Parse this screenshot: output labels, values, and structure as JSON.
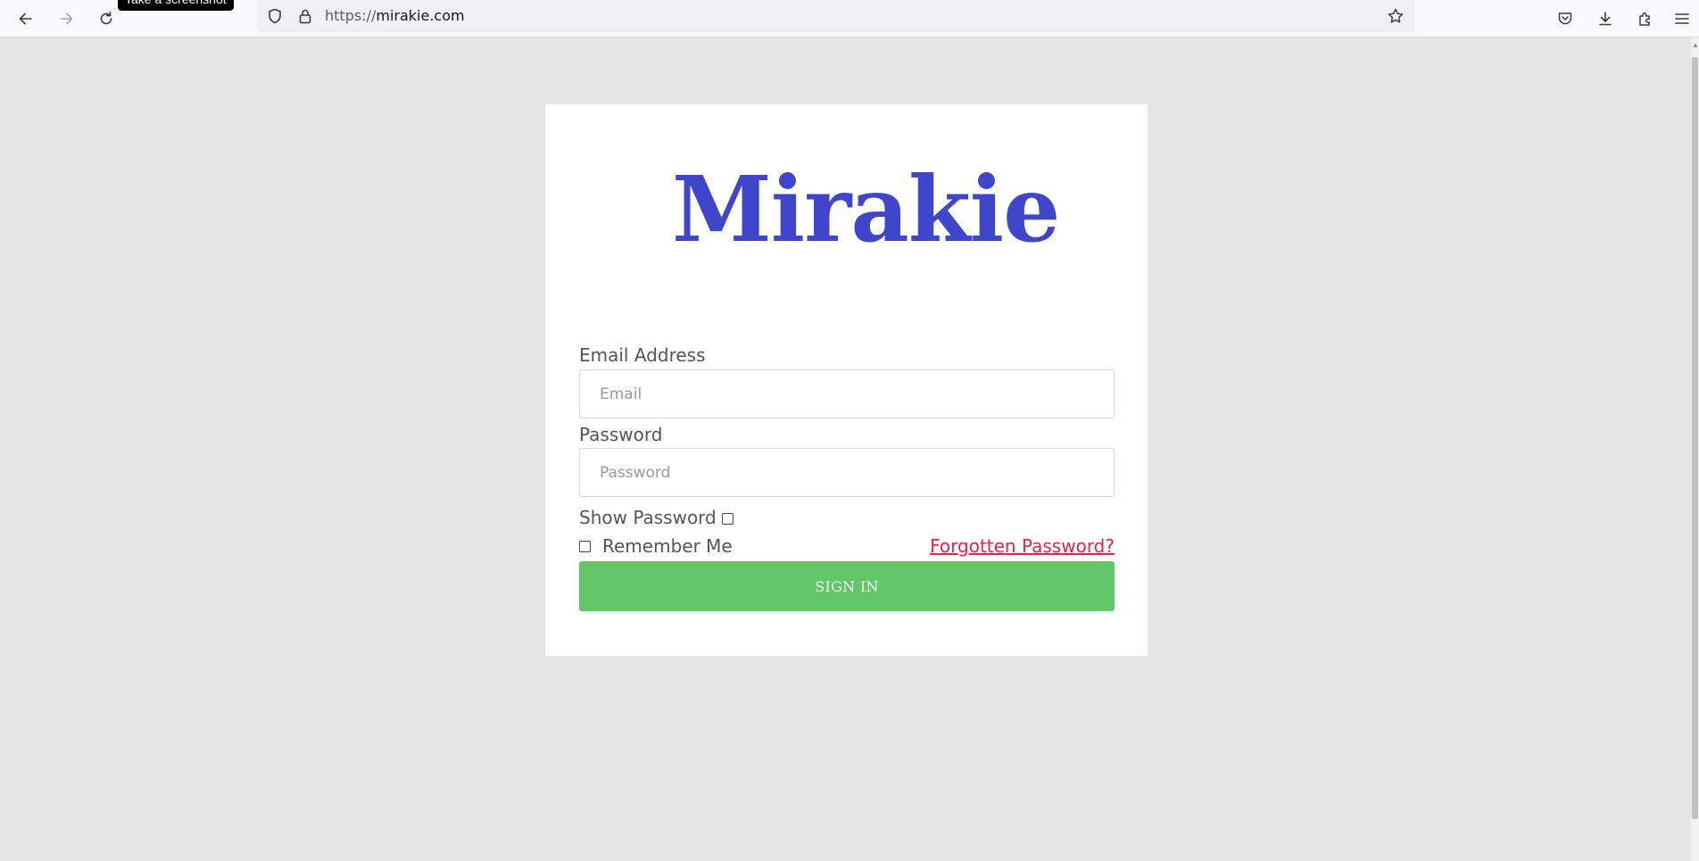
{
  "browser": {
    "tooltip": "Take a screenshot",
    "url_scheme": "https://",
    "url_host": "mirakie.com",
    "icons": {
      "back": "back-arrow-icon",
      "forward": "forward-arrow-icon",
      "reload": "reload-icon",
      "shield": "tracking-protection-shield-icon",
      "lock": "lock-icon",
      "bookmark": "star-icon",
      "pocket": "pocket-icon",
      "downloads": "download-icon",
      "extensions": "puzzle-icon",
      "menu": "hamburger-menu-icon"
    }
  },
  "login": {
    "logo_text": "Mirakie",
    "email_label": "Email Address",
    "email_placeholder": "Email",
    "email_value": "",
    "password_label": "Password",
    "password_placeholder": "Password",
    "password_value": "",
    "show_password_label": "Show Password",
    "show_password_checked": false,
    "remember_me_label": "Remember Me",
    "remember_me_checked": false,
    "forgot_link": "Forgotten Password?",
    "signin_label": "SIGN IN"
  },
  "colors": {
    "brand": "#3f46cc",
    "signin_button": "#63c769",
    "forgot_link": "#e4244a",
    "page_background": "#e5e5e5"
  }
}
